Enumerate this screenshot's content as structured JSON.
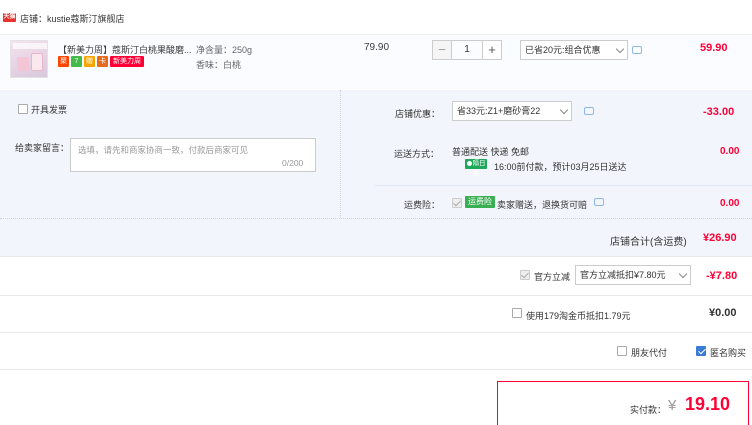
{
  "store": {
    "badge": "天猫",
    "name": "店铺：kustie蔻斯汀旗舰店"
  },
  "item": {
    "title": "【新美力周】蔻斯汀白桃果酸磨...",
    "tags": [
      "聚",
      "7",
      "赠",
      "卡",
      "新美力周"
    ],
    "spec_volume": "净含量：250g",
    "spec_scent": "香味：白桃",
    "unit_price": "79.90",
    "qty_minus": "−",
    "quantity": "1",
    "qty_plus": "+",
    "promo": "已省20元:组合优惠",
    "subtotal": "59.90"
  },
  "invoice": {
    "label": "开具发票"
  },
  "message": {
    "label": "给卖家留言：",
    "placeholder": "选填，请先和商家协商一致，付款后商家可见",
    "count": "0/200"
  },
  "shop_discount": {
    "label": "店铺优惠：",
    "selected": "省33元:Z1+磨砂膏22",
    "amount": "-33.00"
  },
  "shipping": {
    "label": "运送方式：",
    "method": "普通配送 快递 免邮",
    "badge": "隔日达",
    "time": "16:00前付款，预计03月25日送达",
    "fee": "0.00"
  },
  "insurance": {
    "label": "运费险：",
    "tag": "运费险",
    "text": "卖家赠送，退换货可赔",
    "fee": "0.00"
  },
  "store_total": {
    "label": "店铺合计(含运费)",
    "value": "¥26.90"
  },
  "official_discount": {
    "label": "官方立减",
    "selected": "官方立减抵扣¥7.80元",
    "amount": "-¥7.80"
  },
  "tmall_coins": {
    "label": "使用179淘金币抵扣1.79元",
    "amount": "¥0.00"
  },
  "options": {
    "friend_pay": "朋友代付",
    "anonymous": "匿名购买"
  },
  "payable": {
    "label": "实付款：",
    "currency": "¥",
    "value": "19.10"
  },
  "colors": {
    "accent_red": "#ff0036",
    "panel_bg": "#f2f6fc",
    "check_blue": "#3a7bd5"
  }
}
